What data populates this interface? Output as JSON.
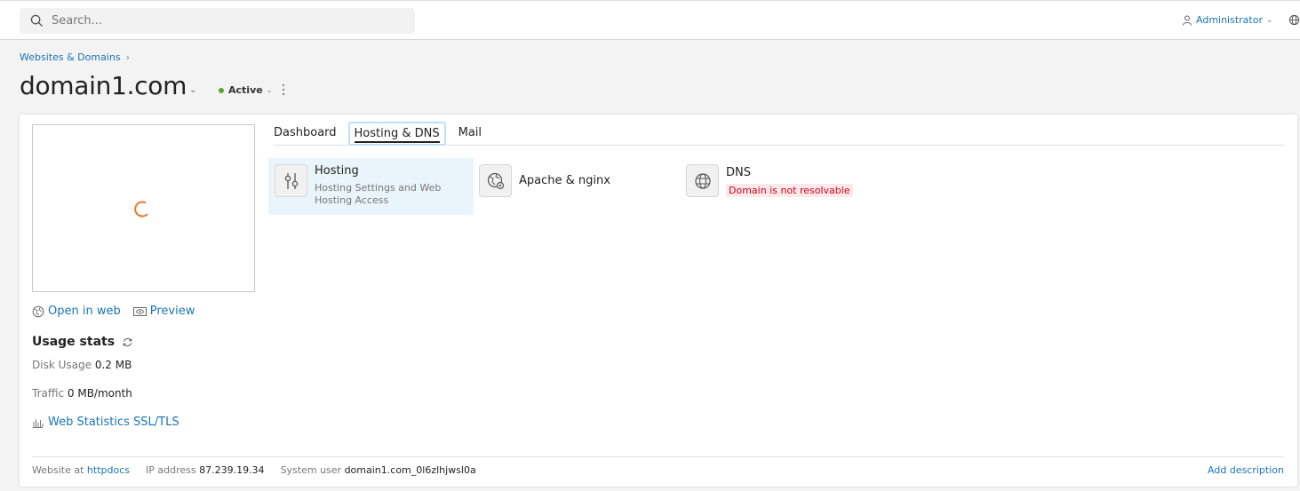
{
  "topbar": {
    "search_placeholder": "Search...",
    "user_label": "Administrator"
  },
  "header": {
    "breadcrumb": "Websites & Domains",
    "title": "domain1.com",
    "status": "Active",
    "status_color": "#5aa423"
  },
  "sidebar": {
    "open_in_web": "Open in web",
    "preview": "Preview",
    "usage_title": "Usage stats",
    "disk_label": "Disk Usage",
    "disk_value": "0.2 MB",
    "traffic_label": "Traffic",
    "traffic_value": "0 MB/month",
    "web_stats": "Web Statistics SSL/TLS"
  },
  "tabs": [
    {
      "label": "Dashboard"
    },
    {
      "label": "Hosting & DNS",
      "active": true
    },
    {
      "label": "Mail"
    }
  ],
  "tiles": {
    "hosting": {
      "name": "Hosting",
      "desc": "Hosting Settings and Web Hosting Access",
      "icon": "sliders-icon"
    },
    "apache": {
      "name": "Apache & nginx",
      "icon": "globe-gear-icon"
    },
    "dns": {
      "name": "DNS",
      "badge": "Domain is not resolvable",
      "icon": "globe-icon",
      "badge_color": "#d0021b"
    }
  },
  "footer": {
    "website_at_label": "Website at",
    "website_at_value": "httpdocs",
    "ip_label": "IP address",
    "ip_value": "87.239.19.34",
    "sysuser_label": "System user",
    "sysuser_value": "domain1.com_0l6zlhjwsl0a",
    "add_description": "Add description"
  },
  "colors": {
    "link": "#1976b6",
    "spinner": "#f0762b"
  }
}
